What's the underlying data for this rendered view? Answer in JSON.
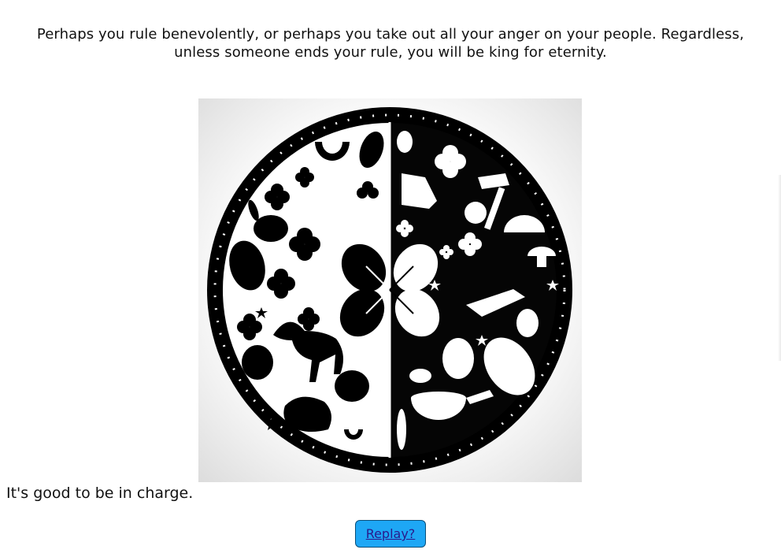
{
  "story": {
    "intro_text": "Perhaps you rule benevolently, or perhaps you take out all your anger on your people. Regardless, unless someone ends your rule, you will be king for eternity.",
    "outro_text": "It's good to be in charge."
  },
  "illustration": {
    "subject": "black and white circular emblem split into light and dark halves with animals, clovers, horseshoes and objects"
  },
  "replay": {
    "label": "Replay?"
  },
  "colors": {
    "button_bg": "#1ea7f5",
    "button_text": "#2a1a8c",
    "text": "#111111"
  }
}
